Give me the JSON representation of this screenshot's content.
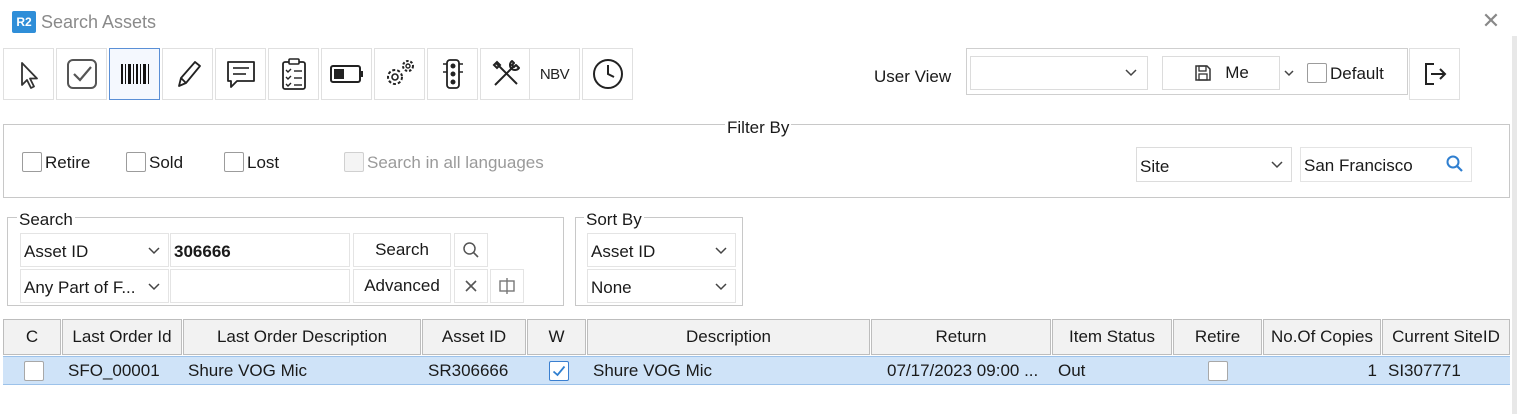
{
  "window": {
    "logo_text": "R2",
    "title": "Search Assets"
  },
  "toolbar": {
    "buttons": [
      {
        "name": "select-arrow-icon"
      },
      {
        "name": "checkbox-icon"
      },
      {
        "name": "barcode-icon"
      },
      {
        "name": "pencil-icon"
      },
      {
        "name": "comment-icon"
      },
      {
        "name": "clipboard-checklist-icon"
      },
      {
        "name": "battery-icon"
      },
      {
        "name": "gears-icon"
      },
      {
        "name": "traffic-light-icon"
      },
      {
        "name": "tools-icon"
      },
      {
        "name": "nbv-icon",
        "text": "NBV"
      },
      {
        "name": "clock-icon"
      }
    ],
    "user_view_label": "User View",
    "user_view_value": "",
    "me_label": "Me",
    "default_label": "Default"
  },
  "filter": {
    "legend": "Filter By",
    "retire_label": "Retire",
    "sold_label": "Sold",
    "lost_label": "Lost",
    "all_languages_label": "Search in all languages",
    "site_field": "Site",
    "site_value": "San Francisco"
  },
  "search": {
    "legend": "Search",
    "field": "Asset ID",
    "value": "306666",
    "match_mode": "Any Part of F...",
    "second_value": "",
    "search_button": "Search",
    "advanced_button": "Advanced"
  },
  "sort": {
    "legend": "Sort By",
    "primary": "Asset ID",
    "secondary": "None"
  },
  "grid": {
    "columns": [
      "C",
      "Last Order Id",
      "Last Order Description",
      "Asset ID",
      "W",
      "Description",
      "Return",
      "Item Status",
      "Retire",
      "No.Of Copies",
      "Current SiteID"
    ],
    "rows": [
      {
        "c": false,
        "last_order_id": "SFO_00001",
        "last_order_description": "Shure VOG Mic",
        "asset_id": "SR306666",
        "w": true,
        "description": "Shure VOG Mic",
        "return": "07/17/2023 09:00 ...",
        "item_status": "Out",
        "retire": false,
        "copies": "1",
        "current_site_id": "SI307771"
      }
    ]
  },
  "colors": {
    "accent": "#2f8ed8",
    "selected_row": "#cfe3f8",
    "header_bg": "#f2f2f2"
  }
}
